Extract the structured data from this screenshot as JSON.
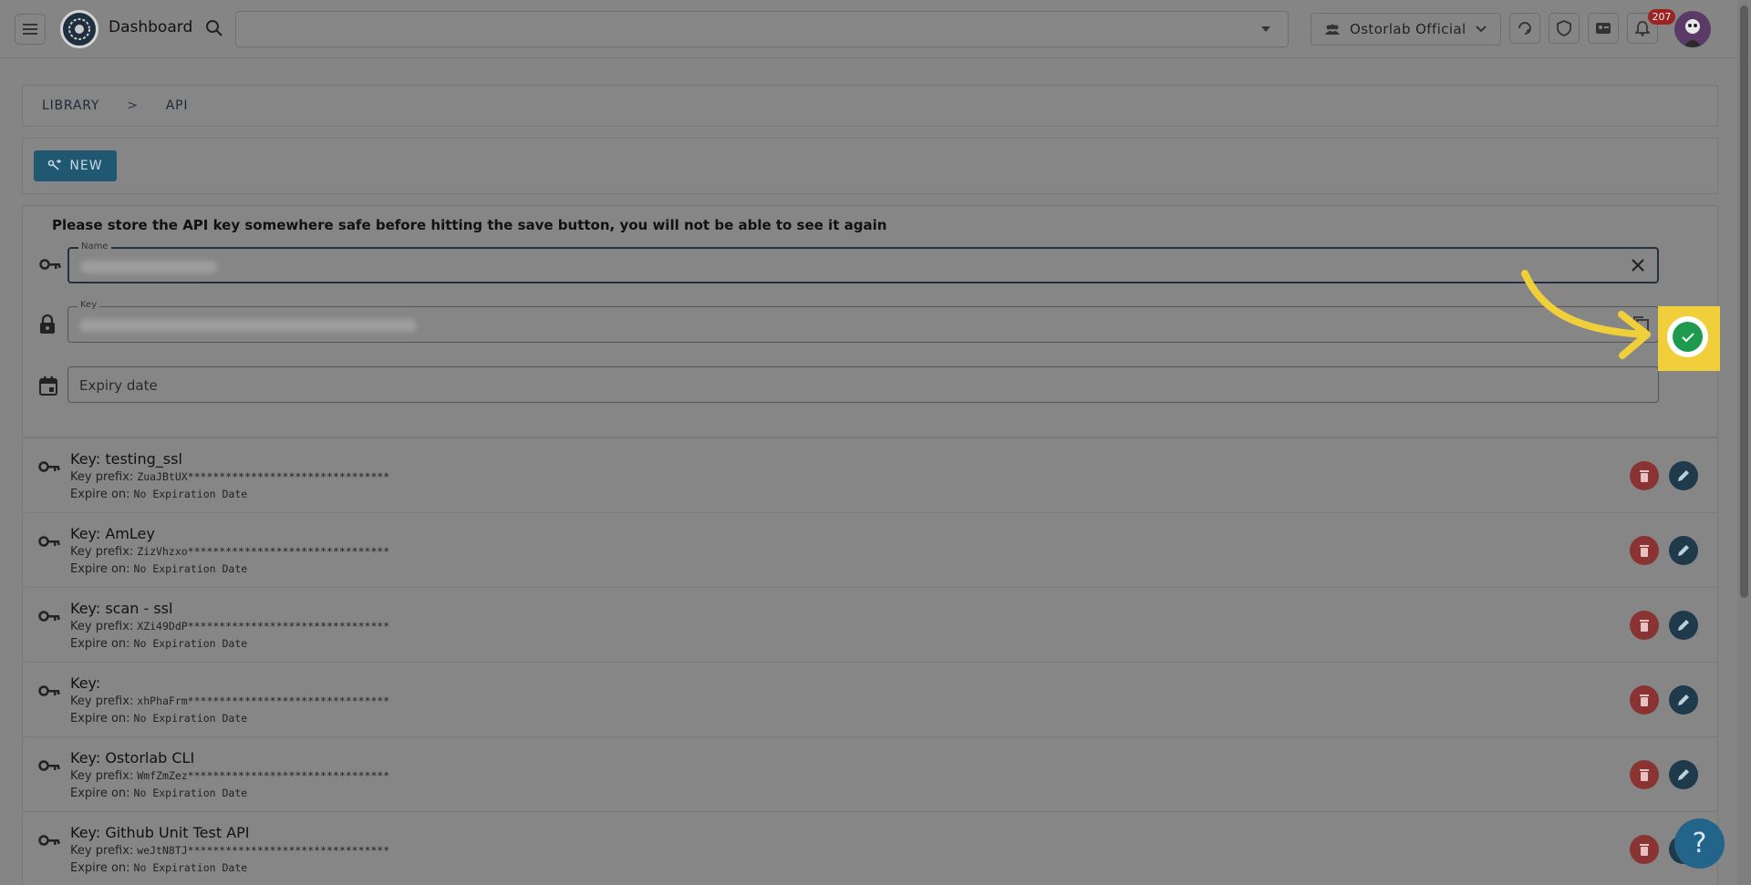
{
  "header": {
    "title": "Dashboard",
    "search_value": "",
    "organization": "Ostorlab Official",
    "notification_count": "207"
  },
  "breadcrumb": {
    "root": "LIBRARY",
    "separator": ">",
    "current": "API"
  },
  "toolbar": {
    "new_label": "NEW"
  },
  "form": {
    "note": "Please store the API key somewhere safe before hitting the save button, you will not be able to see it again",
    "name_label": "Name",
    "key_label": "Key",
    "expiry_placeholder": "Expiry date"
  },
  "keys": [
    {
      "name": "Key: testing_ssl",
      "prefix_label": "Key prefix:",
      "prefix": "ZuaJBtUX********************************",
      "expire_label": "Expire on:",
      "expire": "No Expiration Date"
    },
    {
      "name": "Key: AmLey",
      "prefix_label": "Key prefix:",
      "prefix": "ZizVhzxo********************************",
      "expire_label": "Expire on:",
      "expire": "No Expiration Date"
    },
    {
      "name": "Key: scan - ssl",
      "prefix_label": "Key prefix:",
      "prefix": "XZi49DdP********************************",
      "expire_label": "Expire on:",
      "expire": "No Expiration Date"
    },
    {
      "name": "Key:",
      "prefix_label": "Key prefix:",
      "prefix": "xhPhaFrm********************************",
      "expire_label": "Expire on:",
      "expire": "No Expiration Date"
    },
    {
      "name": "Key: Ostorlab CLI",
      "prefix_label": "Key prefix:",
      "prefix": "WmfZmZez********************************",
      "expire_label": "Expire on:",
      "expire": "No Expiration Date"
    },
    {
      "name": "Key: Github Unit Test API",
      "prefix_label": "Key prefix:",
      "prefix": "weJtN8TJ********************************",
      "expire_label": "Expire on:",
      "expire": "No Expiration Date"
    }
  ],
  "help": {
    "label": "?"
  },
  "colors": {
    "highlight": "#f0cf3a",
    "save_ok": "#1d9a4e",
    "delete": "#8a3333",
    "edit": "#1e3a4b",
    "primary": "#1f5870"
  }
}
